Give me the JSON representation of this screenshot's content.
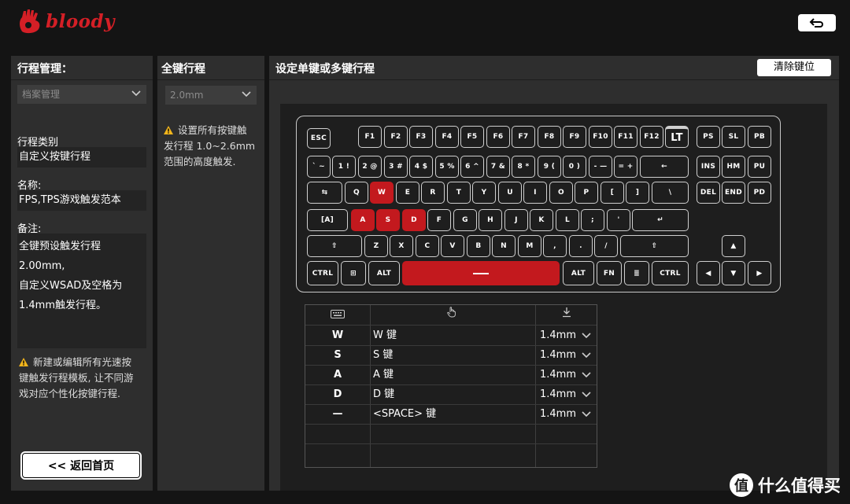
{
  "header": {
    "logo_text": "bloody"
  },
  "left_panel": {
    "title": "行程管理：",
    "profile_select": "档案管理",
    "type_label": "行程类别",
    "type_value": "自定义按键行程",
    "name_label": "名称:",
    "name_value": "FPS,TPS游戏触发范本",
    "note_label": "备注:",
    "note_lines": [
      "全键预设触发行程2.00mm,",
      "自定义WSAD及空格为",
      "1.4mm触发行程。"
    ],
    "warning_lines": [
      "新建或编辑所有光速按",
      "键触发行程模板, 让不同游",
      "戏对应个性化按键行程."
    ],
    "home_button": "<< 返回首页"
  },
  "mid_panel": {
    "title": "全键行程",
    "travel_select": "2.0mm",
    "warning_lines": [
      "设置所有按键触",
      "发行程 1.0~2.6mm",
      "范围的高度触发."
    ]
  },
  "right_panel": {
    "title": "设定单键或多键行程",
    "clear_button": "清除键位"
  },
  "accent_color": "#c3191e",
  "table": {
    "rows": [
      {
        "key": "W",
        "name": "W 键",
        "travel": "1.4mm"
      },
      {
        "key": "S",
        "name": "S 键",
        "travel": "1.4mm"
      },
      {
        "key": "A",
        "name": "A 键",
        "travel": "1.4mm"
      },
      {
        "key": "D",
        "name": "D 键",
        "travel": "1.4mm"
      },
      {
        "key": "—",
        "name": "<SPACE> 键",
        "travel": "1.4mm"
      }
    ]
  },
  "watermark": {
    "badge": "值",
    "text": "什么值得买"
  }
}
